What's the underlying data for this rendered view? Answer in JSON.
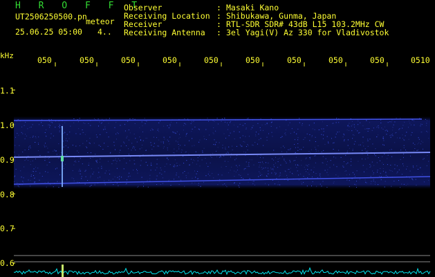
{
  "brand": "H R O F F T",
  "meta": {
    "filename": "UT2506250500.pn",
    "type": "meteor",
    "datetime": "25.06.25 05:00",
    "extra": "4.."
  },
  "header": {
    "labels": [
      "Observer",
      "Receiving Location",
      "Receiver",
      "Receiving Antenna"
    ],
    "colons": [
      ":",
      ":",
      ":",
      ":"
    ],
    "values": [
      "Masaki Kano",
      "Shibukawa, Gunma, Japan",
      "RTL-SDR SDR# 43dB L15 103.2MHz CW",
      "3el Yagi(V) Az 330 for Vladivostok"
    ]
  },
  "axis": {
    "unit": "kHz",
    "x_ticks": [
      "050",
      "050",
      "050",
      "050",
      "050",
      "050",
      "050",
      "050",
      "050",
      "0510"
    ],
    "y_ticks": [
      "1.1",
      "1.0",
      "0.9",
      "0.8",
      "0.7",
      "0.6"
    ]
  },
  "colors": {
    "text": "#ffff33",
    "brand": "#33dd33",
    "band": "#2a36c8",
    "line": "#6f82ff",
    "baseline": "#00e5ee"
  }
}
